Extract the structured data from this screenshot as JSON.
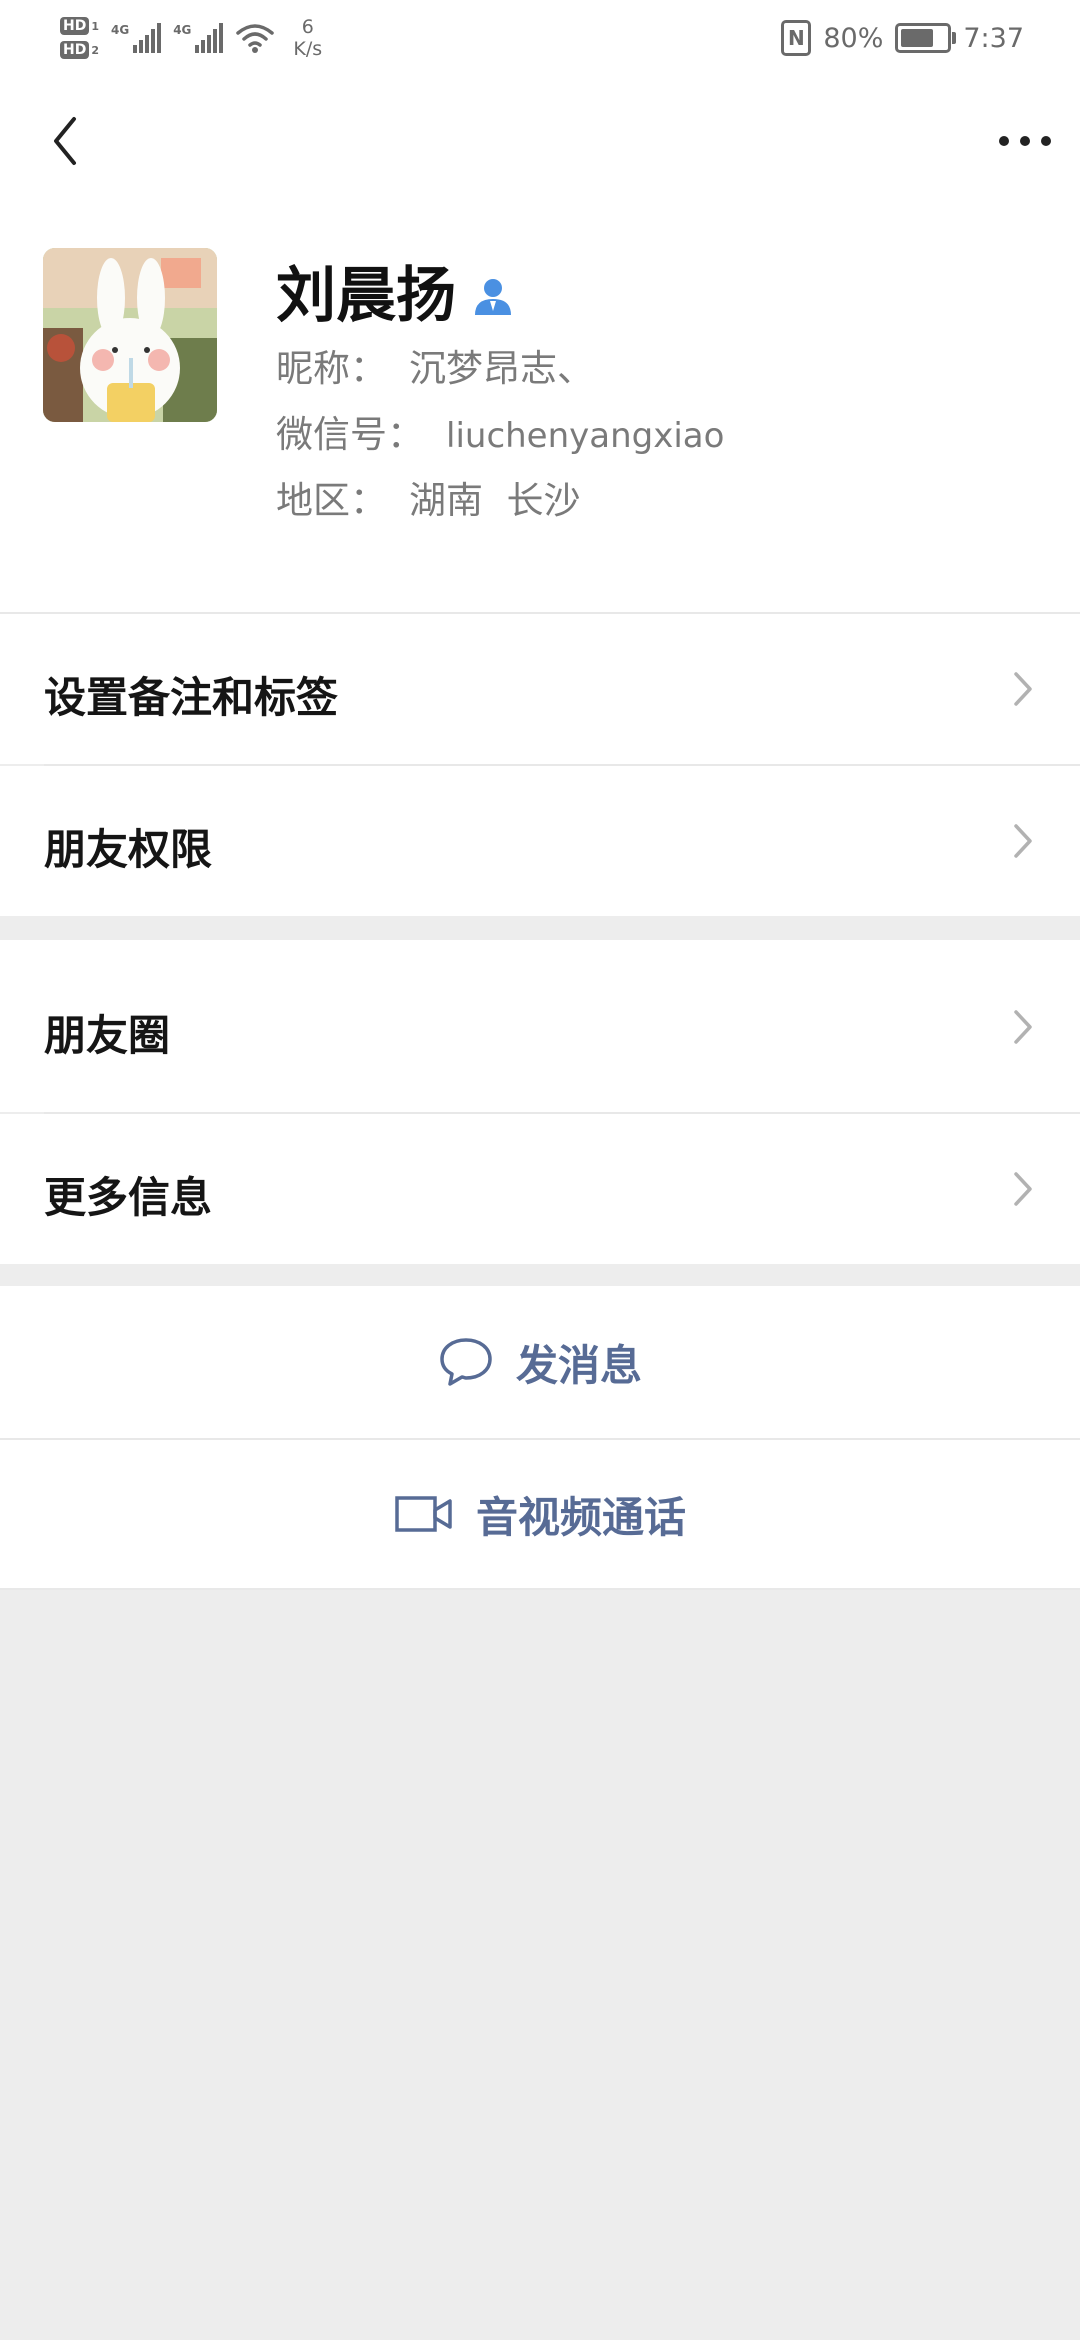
{
  "status_bar": {
    "hd1": "HD",
    "hd1_sub": "1",
    "hd2": "HD",
    "hd2_sub": "2",
    "sim1_network": "4G",
    "sim2_network": "4G",
    "speed_value": "6",
    "speed_unit": "K/s",
    "battery_percent": "80%",
    "battery_level": 0.8,
    "time": "7:37"
  },
  "nav": {
    "back_icon": "chevron-left-icon",
    "more_icon": "ellipsis-icon"
  },
  "profile": {
    "name": "刘晨扬",
    "badge_icon": "person-icon",
    "badge_color": "#4a90e2",
    "nickname_label": "昵称：",
    "nickname": "沉梦昂志、",
    "wechat_id_label": "微信号：",
    "wechat_id": "liuchenyangxiao",
    "region_label": "地区：",
    "region": "湖南  长沙"
  },
  "menu": {
    "group1": [
      "设置备注和标签",
      "朋友权限"
    ],
    "group2": [
      "朋友圈",
      "更多信息"
    ]
  },
  "actions": {
    "message_label": "发消息",
    "message_icon": "chat-bubble-icon",
    "video_label": "音视频通话",
    "video_icon": "video-camera-icon",
    "link_color": "#576b95"
  }
}
